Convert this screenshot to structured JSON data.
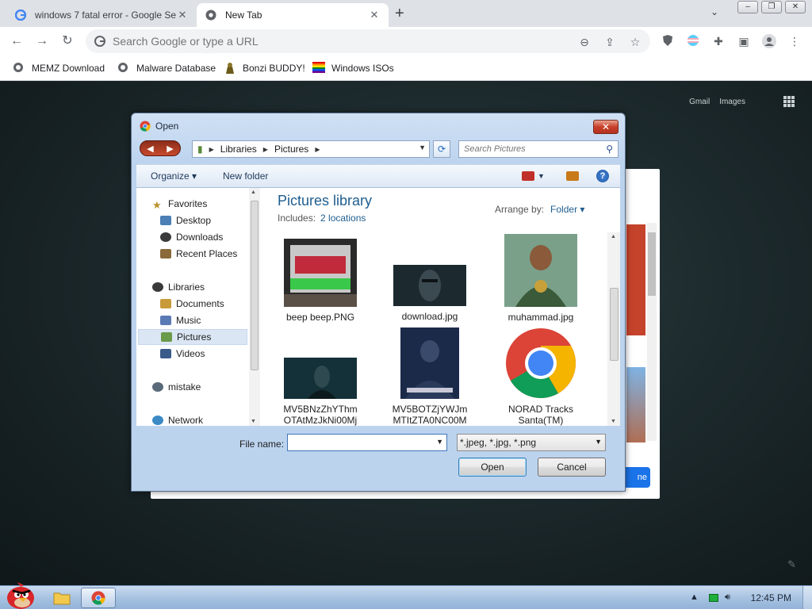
{
  "browser": {
    "tabs": [
      {
        "title": "windows 7 fatal error - Google Se"
      },
      {
        "title": "New Tab"
      }
    ],
    "new_tab_glyph": "+",
    "omnibox_placeholder": "Search Google or type a URL",
    "bookmarks": [
      {
        "label": "MEMZ Download",
        "icon": "globe-icon"
      },
      {
        "label": "Malware Database",
        "icon": "globe-icon"
      },
      {
        "label": "Bonzi BUDDY!",
        "icon": "bonzi-icon"
      },
      {
        "label": "Windows ISOs",
        "icon": "rainbow-flag-icon"
      }
    ],
    "page_links": {
      "gmail": "Gmail",
      "images": "Images"
    },
    "partial_button": "ne"
  },
  "dialog": {
    "title": "Open",
    "breadcrumb": [
      "Libraries",
      "Pictures"
    ],
    "search_placeholder": "Search Pictures",
    "commands": {
      "organize": "Organize",
      "new_folder": "New folder"
    },
    "nav": {
      "favorites": "Favorites",
      "desktop": "Desktop",
      "downloads": "Downloads",
      "recent": "Recent Places",
      "libraries": "Libraries",
      "documents": "Documents",
      "music": "Music",
      "pictures": "Pictures",
      "videos": "Videos",
      "homegroup": "mistake",
      "network": "Network"
    },
    "library_title": "Pictures library",
    "includes_label": "Includes:",
    "includes_link": "2 locations",
    "arrange_label": "Arrange by:",
    "arrange_value": "Folder",
    "files": [
      {
        "name": "beep beep.PNG"
      },
      {
        "name": "download.jpg"
      },
      {
        "name": "muhammad.jpg"
      },
      {
        "name_l1": "MV5BNzZhYThm",
        "name_l2": "OTAtMzJkNi00Mj"
      },
      {
        "name_l1": "MV5BOTZjYWJm",
        "name_l2": "MTItZTA0NC00M"
      },
      {
        "name_l1": "NORAD Tracks",
        "name_l2": "Santa(TM)"
      }
    ],
    "filename_label": "File name:",
    "filename_value": "",
    "filetype": "*.jpeg, *.jpg, *.png",
    "open_label": "Open",
    "cancel_label": "Cancel"
  },
  "taskbar": {
    "clock": "12:45 PM"
  },
  "colors": {
    "dialog_frame": "#bcd3ee",
    "library_title": "#1e5d8f",
    "close_red": "#c7402b"
  }
}
